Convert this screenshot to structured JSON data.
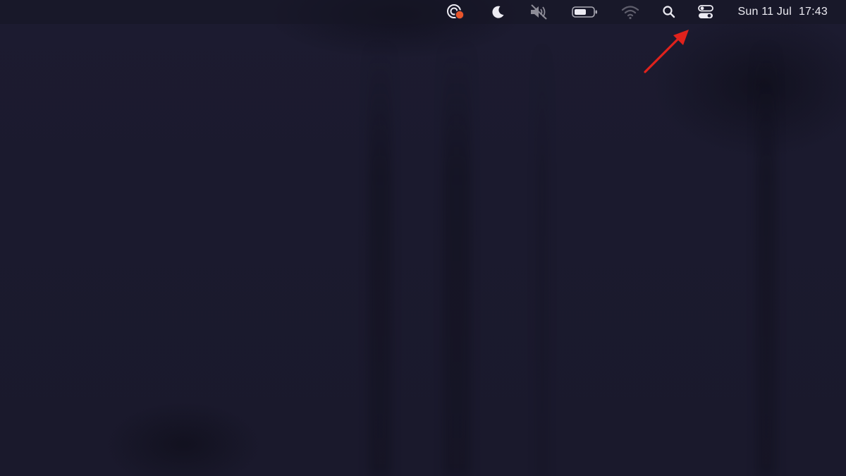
{
  "menubar": {
    "status_icons": [
      {
        "icon": "screen-recorder-icon",
        "badge_color": "#e8552b"
      },
      {
        "icon": "moon-icon"
      },
      {
        "icon": "speaker-muted-icon"
      },
      {
        "icon": "battery-icon"
      },
      {
        "icon": "wifi-icon"
      },
      {
        "icon": "search-icon"
      },
      {
        "icon": "control-center-icon"
      }
    ],
    "clock": {
      "date": "Sun 11 Jul",
      "time": "17:43"
    }
  },
  "annotation": {
    "icon": "red-arrow-icon",
    "color": "#e0221c",
    "points_to": "control-center-icon"
  },
  "colors": {
    "menubar_text": "#ecebf2",
    "wallpaper": "#1b1a2e"
  }
}
